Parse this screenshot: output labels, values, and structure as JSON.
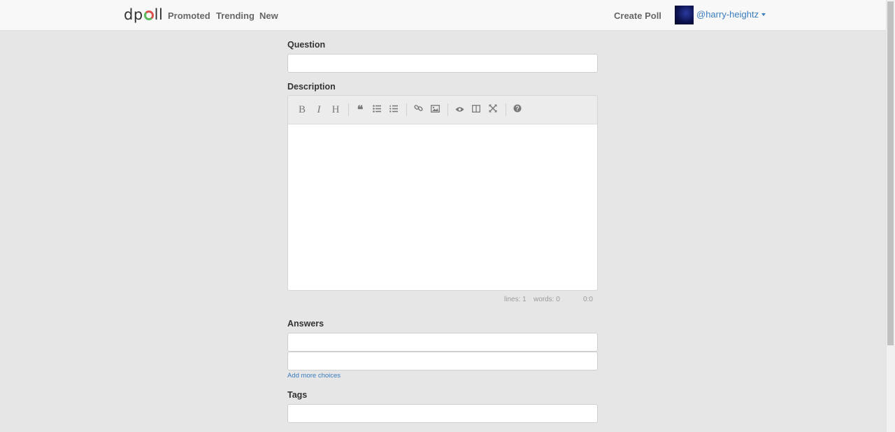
{
  "nav": {
    "logo": "dpoll",
    "links": [
      "Promoted",
      "Trending",
      "New"
    ],
    "create_poll": "Create Poll",
    "user": "@harry-heightz"
  },
  "form": {
    "question_label": "Question",
    "description_label": "Description",
    "answers_label": "Answers",
    "add_more": "Add more choices",
    "tags_label": "Tags"
  },
  "editor": {
    "toolbar": [
      "bold-icon",
      "italic-icon",
      "heading-icon",
      "quote-icon",
      "unordered-list-icon",
      "ordered-list-icon",
      "link-icon",
      "image-icon",
      "preview-icon",
      "side-by-side-icon",
      "fullscreen-icon",
      "guide-icon"
    ],
    "status": {
      "lines": "lines: 1",
      "words": "words: 0",
      "cursor": "0:0"
    }
  },
  "colors": {
    "accent": "#3a7bbf",
    "logo_green": "#5cb85c",
    "logo_red": "#d9534f"
  }
}
